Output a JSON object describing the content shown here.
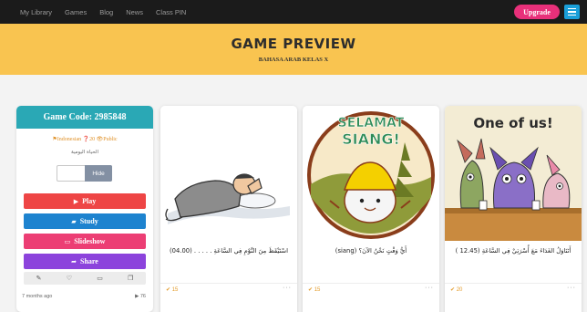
{
  "nav": {
    "links": [
      "My Library",
      "Games",
      "Blog",
      "News",
      "Class PIN"
    ],
    "upgrade_label": "Upgrade",
    "menu_icon": "hamburger-icon"
  },
  "header": {
    "title": "Game Preview",
    "subtitle": "BAHASA ARAB KELAS X"
  },
  "game": {
    "code_label": "Game Code: 2985848",
    "language": "Indonesian",
    "question_count": "20",
    "visibility": "Public",
    "arabic_title": "الحياة اليومية",
    "hide_label": "Hide",
    "buttons": {
      "play": "Play",
      "study": "Study",
      "slideshow": "Slideshow",
      "share": "Share"
    },
    "created": "7 months ago",
    "plays": "76"
  },
  "cards": [
    {
      "text": "اسْتَيْقَظَ مِنَ النَّوْمِ فِي السَّاعَةِ . . . . . (04.00)",
      "score": "15",
      "icon": "sleeping-man-illustration"
    },
    {
      "text": "أَيُّ وَقْتٍ نَحْنُ الآنَ؟ (siang)",
      "score": "15",
      "icon": "selamat-siang-sticker"
    },
    {
      "text": "أَتَنَاوَلُ الغَدَاءَ مَعَ أُسْرَتِيْ فِي السَّاعَةِ (12.45 )",
      "score": "20",
      "icon": "one-of-us-cartoon"
    }
  ],
  "sticker_text": {
    "line1": "SELAMAT",
    "line2": "SIANG!"
  },
  "cartoon_text": "One of us!",
  "colors": {
    "banner": "#f9c450",
    "panel_header": "#2aa8b5",
    "play": "#ee4545",
    "study": "#1e83cf",
    "slideshow": "#ec3e74",
    "share": "#8c43dc",
    "upgrade": "#e8307a"
  }
}
